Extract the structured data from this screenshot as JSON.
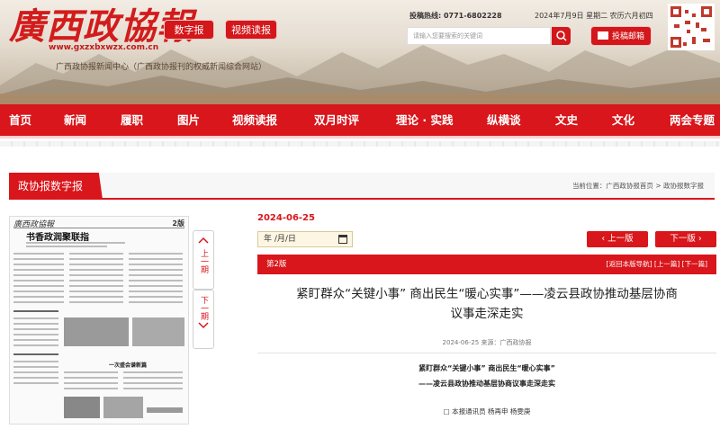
{
  "header": {
    "logo_text": "廣西政協報",
    "logo_url": "www.gxzxbxwzx.com.cn",
    "subtitle": "广西政协报新闻中心（广西政协报刊的权威新闻综合网站）",
    "btn_digital": "数字报",
    "btn_video": "视频读报",
    "hotline": "投稿热线: 0771-6802228",
    "date": "2024年7月9日 星期二 农历六月初四",
    "search_placeholder": "请输入您要搜索的关键词",
    "btn_mailbox": "投稿邮箱"
  },
  "nav": {
    "items": [
      "首页",
      "新闻",
      "履职",
      "图片",
      "视频读报",
      "双月时评",
      "理论 · 实践",
      "纵横谈",
      "文史",
      "文化",
      "两会专题"
    ]
  },
  "section": {
    "tab": "政协报数字报",
    "breadcrumb": "当前位置：广西政协报首页 > 政协报数字报"
  },
  "paper_thumb": {
    "masthead": "廣西政協報",
    "issue": "2版",
    "headline": "书香政润聚联指",
    "prev_page": "上一期",
    "next_page": "下一期",
    "bottom_headline": "一次盛会谱新篇"
  },
  "article": {
    "pub_date": "2024-06-25",
    "date_input": "年 /月/日",
    "prev_edition": "上一版",
    "next_edition": "下一版",
    "page_label": "第2版",
    "page_links": "[返回本版导航]  [上一篇]  [下一篇]",
    "title_line1": "紧盯群众“关键小事” 商出民生“暖心实事”——凌云县政协推动基层协商",
    "title_line2": "议事走深走实",
    "meta": "2024-06-25  来源：广西政协报",
    "heading_main": "紧盯群众“关键小事” 商出民生“暖心实事”",
    "heading_sub": "——凌云县政协推动基层协商议事走深走实",
    "byline": "□ 本报通讯员  杨再申  杨雯庚"
  },
  "colors": {
    "brand_red": "#d8161b",
    "date_red": "#d8161b"
  }
}
